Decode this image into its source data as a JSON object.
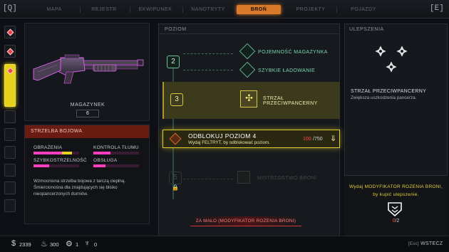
{
  "nav": {
    "left_key": "[Q]",
    "right_key": "[E]",
    "tabs": [
      "MAPA",
      "REJESTR",
      "EKWIPUNEK",
      "NANOTRYTY",
      "BROŃ",
      "PROJEKTY",
      "POJAZDY"
    ],
    "active_tab": "BROŃ"
  },
  "weapon": {
    "magazine_label": "MAGAZYNEK",
    "magazine_value": "6"
  },
  "info": {
    "title": "STRZELBA BOJOWA",
    "stats": [
      {
        "label": "OBRAŻENIA",
        "fill": 0.62,
        "bonus": 0.22
      },
      {
        "label": "KONTROLA TŁUMU",
        "fill": 0.38,
        "bonus": 0
      },
      {
        "label": "SZYBKOSTRZELNOŚĆ",
        "fill": 0.34,
        "bonus": 0
      },
      {
        "label": "OBSŁUGA",
        "fill": 0.26,
        "bonus": 0
      }
    ],
    "description": "Wzmocniona strzelba bojowa z tarczą ciepłną. Śmiercionośna dla znajdujących się blisko nieopancerzonych durniów."
  },
  "levels": {
    "header": "POZIOM",
    "level2": {
      "num": "2",
      "perk1": "POJEMNOŚĆ MAGAZYNKA",
      "perk2": "SZYBKIE ŁADOWANIE"
    },
    "level3": {
      "num": "3",
      "perk": "STRZAŁ PRZECIWPANCERNY"
    },
    "level4": {
      "num": "4",
      "title": "ODBLOKUJ POZIOM 4",
      "subtitle": "Wydaj FELTRYT, by odblokować poziom.",
      "cost_have": "100",
      "cost_need": "/750"
    },
    "level5": {
      "num": "5",
      "perk": "MISTRZOSTWO BRONI"
    },
    "alert": "ZA MAŁO (MODYFIKATOR ROZENIA BRONI)"
  },
  "upgrades": {
    "header": "ULEPSZENIA",
    "name": "STRZAŁ PRZECIWPANCERNY",
    "description": "Zwiększa uszkodzenia pancerza.",
    "requirement": "Wydaj MODYFIKATOR ROZENIA BRONI, by kupić ulepszenie.",
    "count_have": "0",
    "count_need": "/2"
  },
  "bottom": {
    "money": "2339",
    "feltrite": "300",
    "item3": "1",
    "item4": "0",
    "back_key": "[Esc]",
    "back_label": "WSTECZ"
  },
  "colors": {
    "accent_orange": "#d97a2a",
    "accent_yellow": "#e3cd2a",
    "accent_teal": "#6fbf9c",
    "accent_pink": "#ff3fbf",
    "alert_red": "#ff4a4a"
  }
}
